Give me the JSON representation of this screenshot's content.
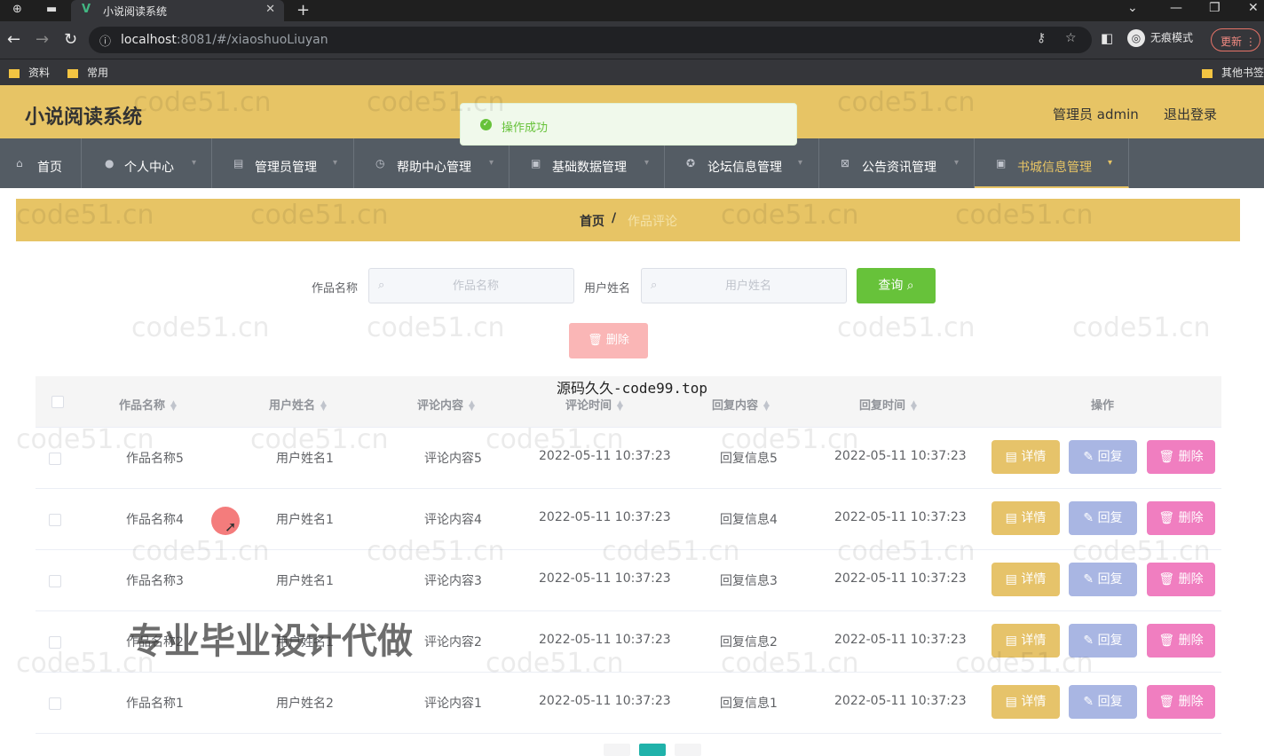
{
  "browser": {
    "tab_title": "小说阅读系统",
    "url_host": "localhost",
    "url_rest": ":8081/#/xiaoshuoLiuyan",
    "incognito_label": "无痕模式",
    "update_label": "更新",
    "bookmarks": [
      "资料",
      "常用"
    ],
    "other_bookmarks": "其他书签"
  },
  "header": {
    "brand": "小说阅读系统",
    "admin_label": "管理员 admin",
    "logout_label": "退出登录"
  },
  "toast": {
    "message": "操作成功"
  },
  "menu": [
    {
      "label": "首页",
      "icon": "home-icon"
    },
    {
      "label": "个人中心",
      "icon": "user-icon"
    },
    {
      "label": "管理员管理",
      "icon": "manager-icon"
    },
    {
      "label": "帮助中心管理",
      "icon": "clock-icon"
    },
    {
      "label": "基础数据管理",
      "icon": "monitor-icon"
    },
    {
      "label": "论坛信息管理",
      "icon": "forum-icon"
    },
    {
      "label": "公告资讯管理",
      "icon": "notice-icon"
    },
    {
      "label": "书城信息管理",
      "icon": "book-icon"
    }
  ],
  "breadcrumb": {
    "home": "首页",
    "separator": "/",
    "current": "作品评论"
  },
  "search": {
    "work_label": "作品名称",
    "work_placeholder": "作品名称",
    "user_label": "用户姓名",
    "user_placeholder": "用户姓名",
    "query_label": "查询",
    "bulk_delete_label": "删除"
  },
  "overlay_caption": "源码久久-code99.top",
  "table": {
    "columns": [
      "作品名称",
      "用户姓名",
      "评论内容",
      "评论时间",
      "回复内容",
      "回复时间",
      "操作"
    ],
    "rows": [
      {
        "work": "作品名称5",
        "user": "用户姓名1",
        "comment": "评论内容5",
        "comment_time": "2022-05-11 10:37:23",
        "reply": "回复信息5",
        "reply_time": "2022-05-11 10:37:23"
      },
      {
        "work": "作品名称4",
        "user": "用户姓名1",
        "comment": "评论内容4",
        "comment_time": "2022-05-11 10:37:23",
        "reply": "回复信息4",
        "reply_time": "2022-05-11 10:37:23"
      },
      {
        "work": "作品名称3",
        "user": "用户姓名1",
        "comment": "评论内容3",
        "comment_time": "2022-05-11 10:37:23",
        "reply": "回复信息3",
        "reply_time": "2022-05-11 10:37:23"
      },
      {
        "work": "作品名称2",
        "user": "用户姓名1",
        "comment": "评论内容2",
        "comment_time": "2022-05-11 10:37:23",
        "reply": "回复信息2",
        "reply_time": "2022-05-11 10:37:23"
      },
      {
        "work": "作品名称1",
        "user": "用户姓名2",
        "comment": "评论内容1",
        "comment_time": "2022-05-11 10:37:23",
        "reply": "回复信息1",
        "reply_time": "2022-05-11 10:37:23"
      }
    ],
    "actions": {
      "detail": "详情",
      "reply": "回复",
      "delete": "删除"
    }
  },
  "watermarks": {
    "site": "code51.cn",
    "ad": "专业毕业设计代做"
  },
  "colors": {
    "header": "#e7c465",
    "menu": "#545c64",
    "success": "#67c23a",
    "detail": "#e6c36a",
    "reply": "#a9b6e3",
    "delete": "#f07ec0"
  }
}
